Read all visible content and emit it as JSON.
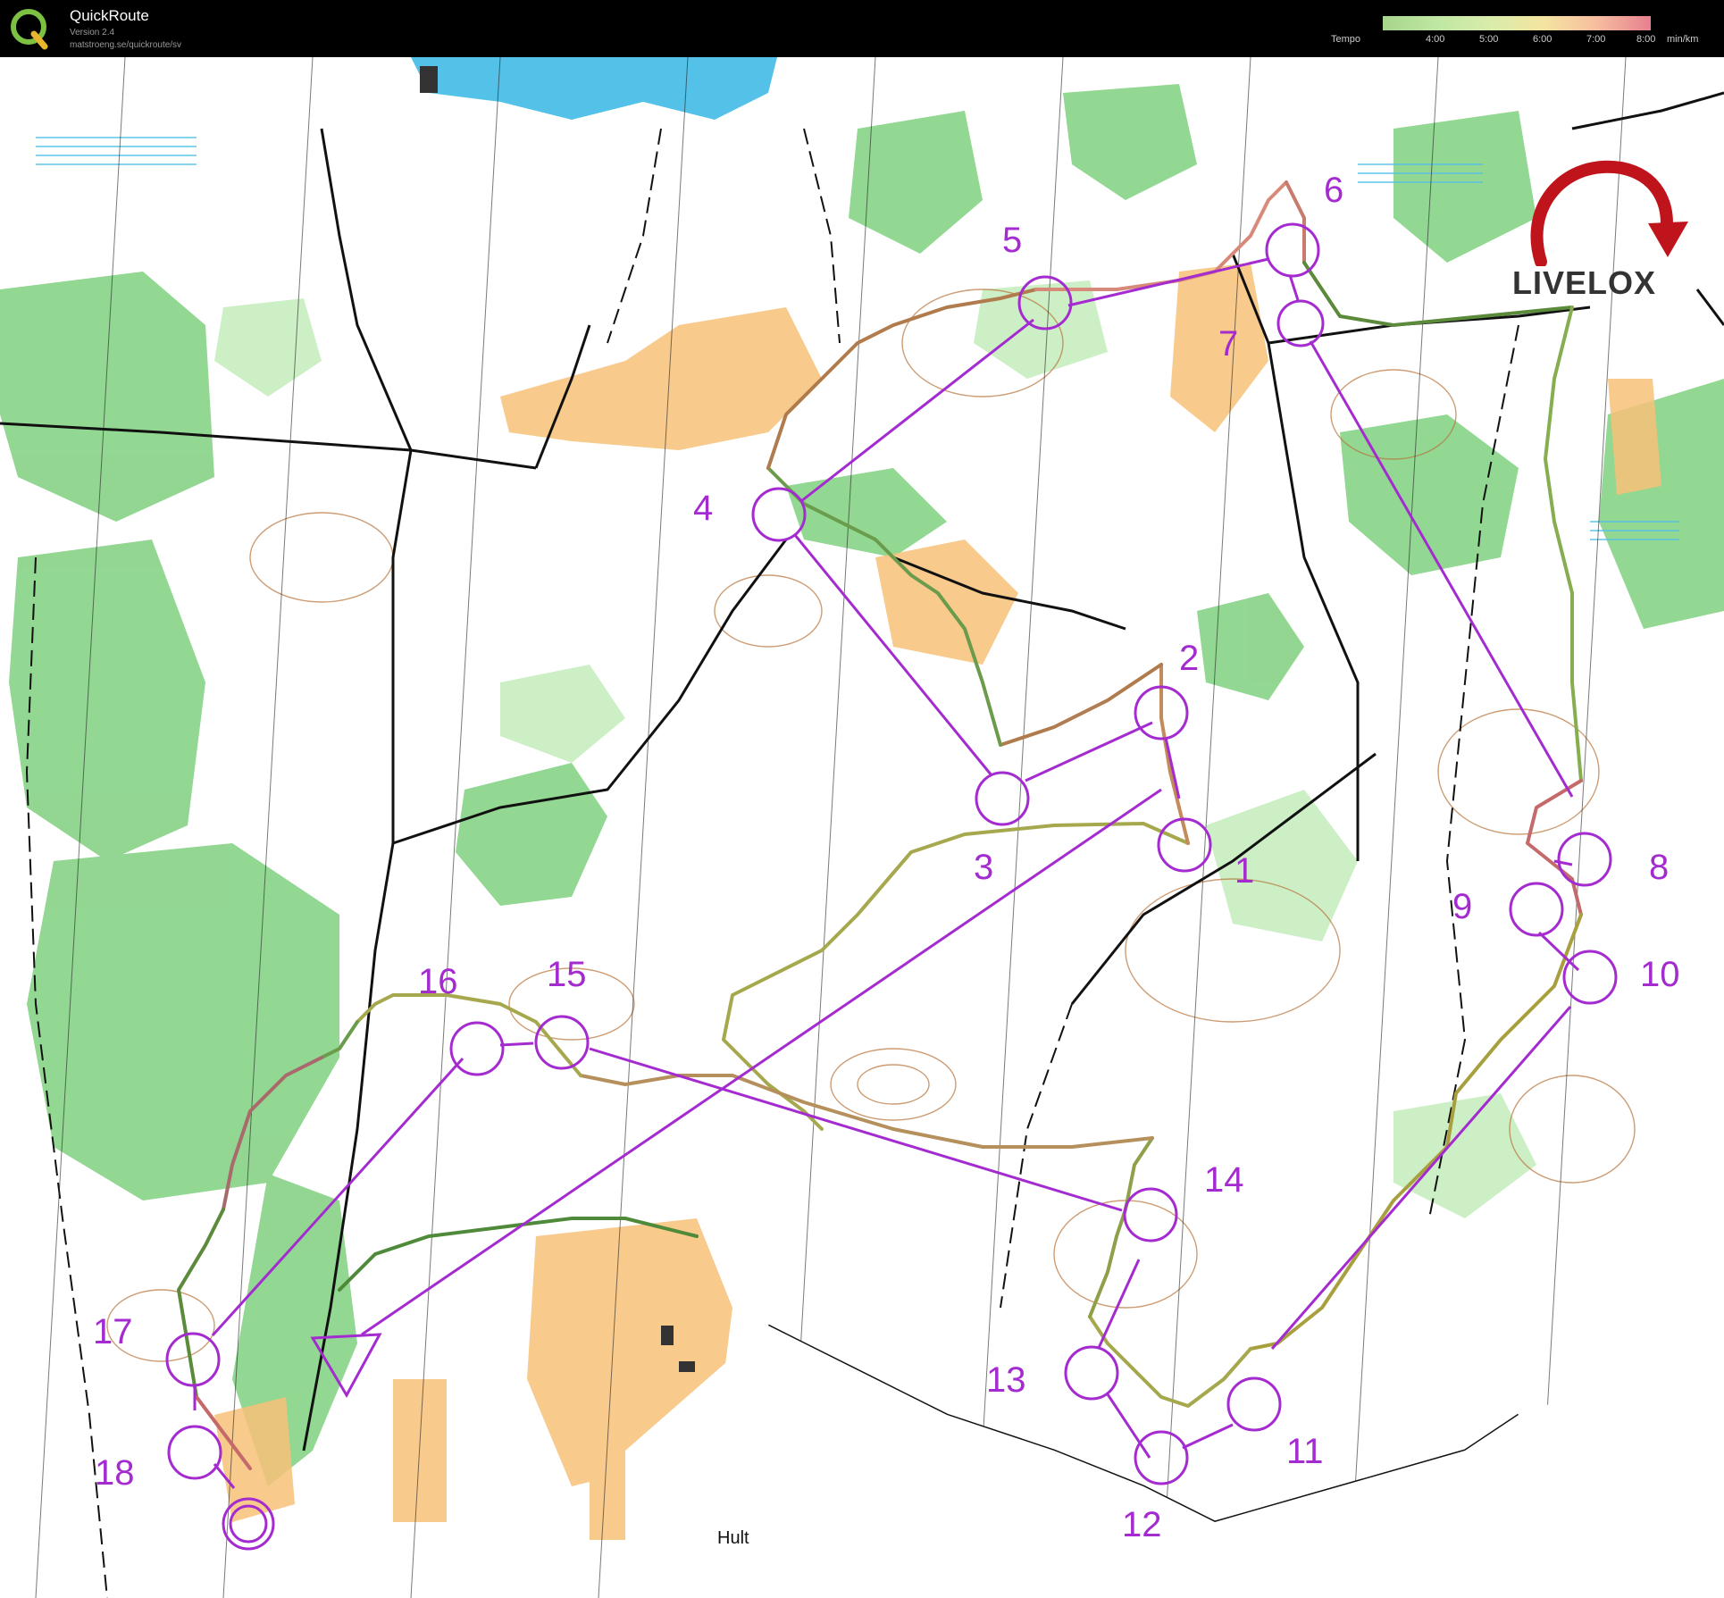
{
  "app": {
    "title": "QuickRoute",
    "version": "Version 2.4",
    "website": "matstroeng.se/quickroute/sv"
  },
  "tempo_legend": {
    "label": "Tempo",
    "ticks": [
      "4:00",
      "5:00",
      "6:00",
      "7:00",
      "8:00"
    ],
    "unit": "min/km"
  },
  "brand": {
    "livelox": "LIVELOX"
  },
  "map": {
    "place_name": "Hult",
    "controls": [
      {
        "number": "1"
      },
      {
        "number": "2"
      },
      {
        "number": "3"
      },
      {
        "number": "4"
      },
      {
        "number": "5"
      },
      {
        "number": "6"
      },
      {
        "number": "7"
      },
      {
        "number": "8"
      },
      {
        "number": "9"
      },
      {
        "number": "10"
      },
      {
        "number": "11"
      },
      {
        "number": "12"
      },
      {
        "number": "13"
      },
      {
        "number": "14"
      },
      {
        "number": "15"
      },
      {
        "number": "16"
      },
      {
        "number": "17"
      },
      {
        "number": "18"
      }
    ],
    "course_color": "#a42bcf"
  }
}
